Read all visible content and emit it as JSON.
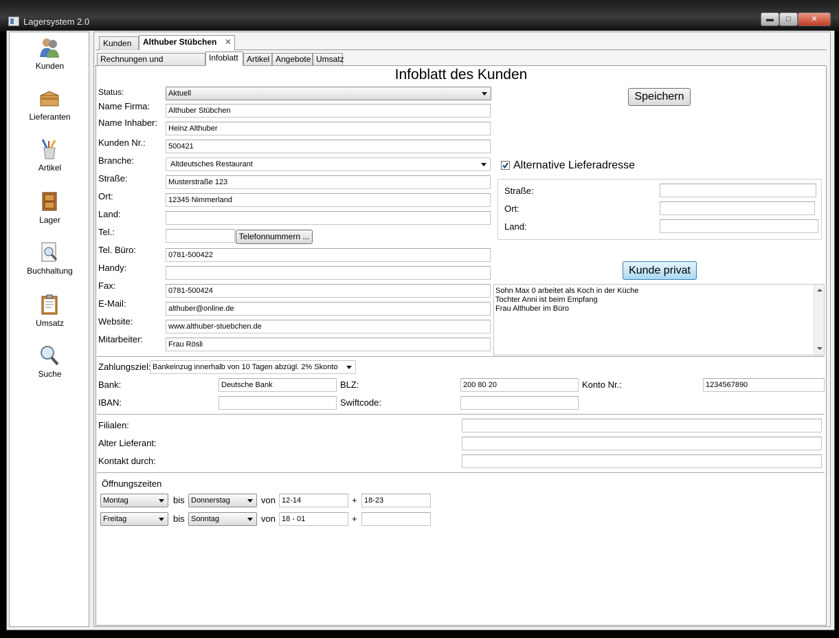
{
  "window": {
    "title": "Lagersystem 2.0",
    "min": "▬",
    "max": "□",
    "close": "✕"
  },
  "sidebar": {
    "items": [
      {
        "label": "Kunden",
        "icon": "customers-icon"
      },
      {
        "label": "Lieferanten",
        "icon": "box-icon"
      },
      {
        "label": "Artikel",
        "icon": "brush-cup-icon"
      },
      {
        "label": "Lager",
        "icon": "cabinet-icon"
      },
      {
        "label": "Buchhaltung",
        "icon": "magnifier-document-icon"
      },
      {
        "label": "Umsatz",
        "icon": "clipboard-icon"
      },
      {
        "label": "Suche",
        "icon": "search-icon"
      }
    ]
  },
  "tabs": {
    "kunden": "Kunden",
    "customer": "Althuber Stübchen",
    "close": "✕"
  },
  "subtabs": [
    "Rechnungen und Lieferscheine",
    "Infoblatt",
    "Artikel",
    "Angebote",
    "Umsatz"
  ],
  "page_title": "Infoblatt des Kunden",
  "form": {
    "status_label": "Status:",
    "status_value": "Aktuell",
    "firma_label": "Name Firma:",
    "firma_value": "Althuber Stübchen",
    "inhaber_label": "Name Inhaber:",
    "inhaber_value": "Heinz Althuber",
    "kundennr_label": "Kunden Nr.:",
    "kundennr_value": "500421",
    "branche_label": "Branche:",
    "branche_value": "Altdeutsches  Restaurant",
    "strasse_label": "Straße:",
    "strasse_value": "Musterstraße 123",
    "ort_label": "Ort:",
    "ort_value": "12345 Nimmerland",
    "land_label": "Land:",
    "land_value": "",
    "tel_label": "Tel.:",
    "tel_value": "",
    "telefonnummern_button": "Telefonnummern ...",
    "telbuero_label": "Tel. Büro:",
    "telbuero_value": "0781-500422",
    "handy_label": "Handy:",
    "handy_value": "",
    "fax_label": "Fax:",
    "fax_value": "0781-500424",
    "email_label": "E-Mail:",
    "email_value": "althuber@online.de",
    "website_label": "Website:",
    "website_value": "www.althuber-stuebchen.de",
    "mitarbeiter_label": "Mitarbeiter:",
    "mitarbeiter_value": "Frau Rösli"
  },
  "save_button": "Speichern",
  "alt_address": {
    "checkbox_label": "Alternative Lieferadresse",
    "checked": true,
    "strasse_label": "Straße:",
    "strasse_value": "",
    "ort_label": "Ort:",
    "ort_value": "",
    "land_label": "Land:",
    "land_value": ""
  },
  "privat_button": "Kunde privat",
  "notes": [
    "Sohn  Max 0  arbeitet als Koch in der Küche",
    "Tochter  Anni  ist beim Empfang",
    "Frau Althuber im Büro"
  ],
  "payment": {
    "ziel_label": "Zahlungsziel:",
    "ziel_value": "Bankeinzug innerhalb von 10 Tagen abzügl. 2% Skonto",
    "bank_label": "Bank:",
    "bank_value": "Deutsche Bank",
    "blz_label": "BLZ:",
    "blz_value": "200 80 20",
    "konto_label": "Konto Nr.:",
    "konto_value": "1234567890",
    "iban_label": "IBAN:",
    "iban_value": "",
    "swift_label": "Swiftcode:",
    "swift_value": ""
  },
  "extra": {
    "filialen_label": "Filialen:",
    "filialen_value": "",
    "alter_label": "Alter Lieferant:",
    "alter_value": "",
    "kontakt_label": "Kontakt durch:",
    "kontakt_value": ""
  },
  "hours": {
    "title": "Öffnungszeiten",
    "bis": "bis",
    "von": "von",
    "plus": "+",
    "rows": [
      {
        "from_day": "Montag",
        "to_day": "Donnerstag",
        "time1": "12-14",
        "time2": "18-23"
      },
      {
        "from_day": "Freitag",
        "to_day": "Sonntag",
        "time1": "18 - 01",
        "time2": ""
      }
    ]
  }
}
